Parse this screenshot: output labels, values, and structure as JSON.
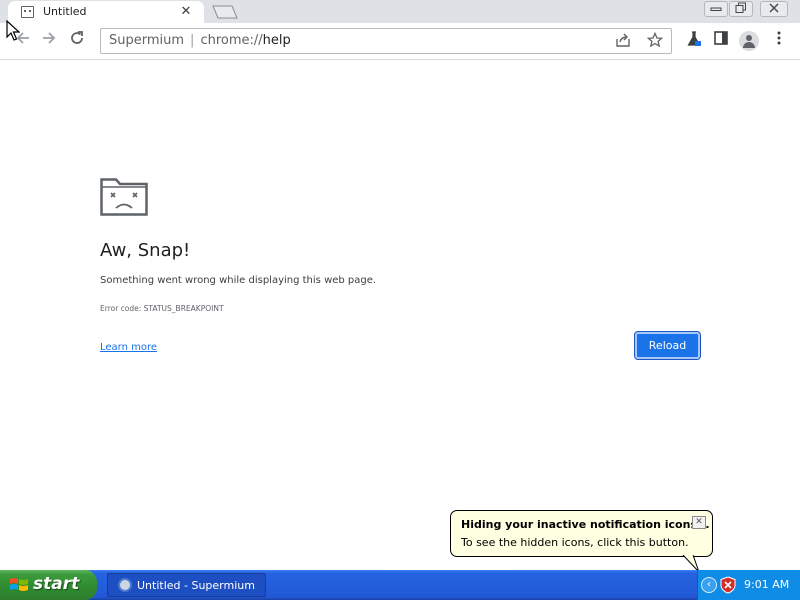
{
  "tab": {
    "title": "Untitled",
    "close_glyph": "✕"
  },
  "window_controls": [
    "minimize-icon",
    "restore-icon",
    "close-icon"
  ],
  "toolbar": {
    "omnibox_brand": "Supermium",
    "omnibox_scheme": "chrome://",
    "omnibox_host": "help"
  },
  "page": {
    "title": "Aw, Snap!",
    "message": "Something went wrong while displaying this web page.",
    "error_code": "Error code: STATUS_BREAKPOINT",
    "learn_more": "Learn more",
    "reload": "Reload"
  },
  "balloon": {
    "title": "Hiding your inactive notification icons...",
    "text": "To see the hidden icons, click this button.",
    "close_glyph": "✕"
  },
  "taskbar": {
    "start_label": "start",
    "task_label": "Untitled - Supermium",
    "clock": "9:01 AM",
    "tray_expand_glyph": "‹"
  },
  "colors": {
    "accent": "#1a73e8",
    "taskbar_blue": "#245edb",
    "start_green": "#2f8a2f",
    "balloon_bg": "#ffffe1"
  }
}
